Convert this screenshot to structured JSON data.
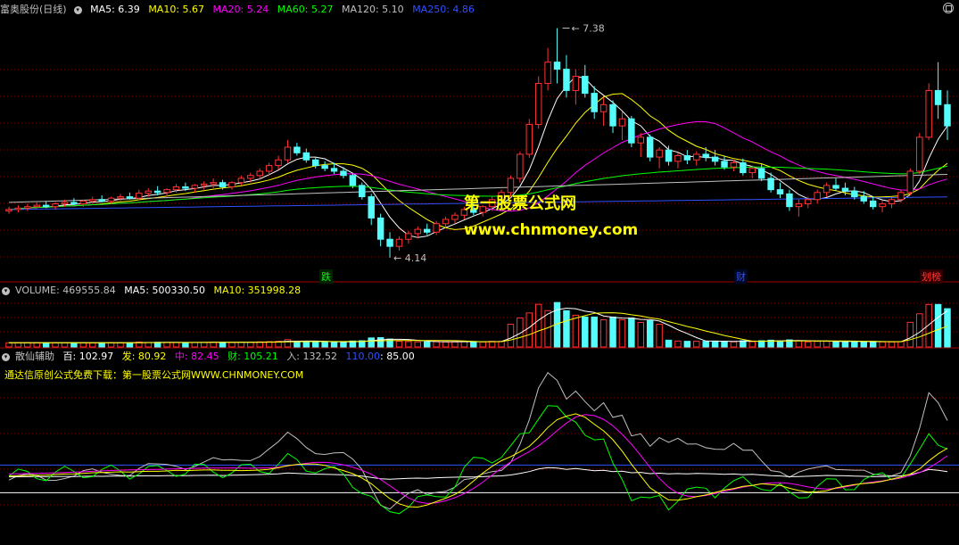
{
  "headers": {
    "main": {
      "name": "富奥股份(日线)",
      "ma": [
        {
          "label": "MA5: 6.39",
          "color": "#ffffff"
        },
        {
          "label": "MA10: 5.67",
          "color": "#ffff00"
        },
        {
          "label": "MA20: 5.24",
          "color": "#ff00ff"
        },
        {
          "label": "MA60: 5.27",
          "color": "#00ff00"
        },
        {
          "label": "MA120: 5.10",
          "color": "#c0c0c0"
        },
        {
          "label": "MA250: 4.86",
          "color": "#3050ff"
        }
      ]
    },
    "volume": [
      {
        "label": "VOLUME: 469555.84",
        "color": "#c0c0c0"
      },
      {
        "label": "MA5: 500330.50",
        "color": "#ffffff"
      },
      {
        "label": "MA10: 351998.28",
        "color": "#ffff00"
      }
    ],
    "indicator": [
      {
        "label": "散仙辅助",
        "color": "#c0c0c0"
      },
      {
        "label": "百: 102.97",
        "color": "#ffffff"
      },
      {
        "label": "发: 80.92",
        "color": "#ffff00"
      },
      {
        "label": "中: 82.45",
        "color": "#ff00ff"
      },
      {
        "label": "财: 105.21",
        "color": "#00ff00"
      },
      {
        "label": "入: 132.52",
        "color": "#c0c0c0"
      },
      {
        "label": "110.00",
        "color": "#3050ff"
      },
      {
        "label": ": 85.00",
        "color": "#ffffff"
      }
    ],
    "indicator_note": "通达信原创公式免费下载：第一股票公式网WWW.CHNMONEY.COM"
  },
  "watermark": {
    "line1": "第一股票公式网",
    "line2": "www.chnmoney.com"
  },
  "annotations": {
    "high": "7.38",
    "low": "4.14",
    "low_marker": "跌",
    "marker_cai": "财",
    "marker_right": "划榜"
  },
  "colors": {
    "up": "#ff3232",
    "down": "#54fcfc",
    "grid": "#7a0000",
    "divider": "#a00000"
  },
  "chart_data": [
    {
      "type": "candlestick",
      "title": "富奥股份(日线)",
      "ylim": [
        4.0,
        7.5
      ],
      "series_note": "approximate daily OHLC, left to right",
      "ohlc": [
        [
          4.8,
          4.86,
          4.76,
          4.82
        ],
        [
          4.82,
          4.88,
          4.78,
          4.84
        ],
        [
          4.84,
          4.9,
          4.8,
          4.86
        ],
        [
          4.86,
          4.92,
          4.82,
          4.88
        ],
        [
          4.88,
          4.94,
          4.84,
          4.86
        ],
        [
          4.86,
          4.92,
          4.82,
          4.9
        ],
        [
          4.9,
          4.96,
          4.86,
          4.92
        ],
        [
          4.92,
          4.98,
          4.88,
          4.9
        ],
        [
          4.9,
          4.96,
          4.86,
          4.94
        ],
        [
          4.94,
          5.0,
          4.9,
          4.96
        ],
        [
          4.96,
          5.02,
          4.92,
          4.94
        ],
        [
          4.94,
          5.0,
          4.9,
          4.98
        ],
        [
          4.98,
          5.04,
          4.94,
          5.0
        ],
        [
          5.0,
          5.06,
          4.96,
          4.98
        ],
        [
          4.98,
          5.1,
          4.95,
          5.05
        ],
        [
          5.05,
          5.12,
          5.0,
          5.08
        ],
        [
          5.08,
          5.15,
          5.02,
          5.06
        ],
        [
          5.06,
          5.12,
          5.0,
          5.1
        ],
        [
          5.1,
          5.18,
          5.06,
          5.14
        ],
        [
          5.14,
          5.2,
          5.08,
          5.12
        ],
        [
          5.12,
          5.18,
          5.06,
          5.16
        ],
        [
          5.16,
          5.22,
          5.1,
          5.18
        ],
        [
          5.18,
          5.26,
          5.12,
          5.2
        ],
        [
          5.2,
          5.24,
          5.1,
          5.14
        ],
        [
          5.14,
          5.22,
          5.1,
          5.2
        ],
        [
          5.2,
          5.3,
          5.16,
          5.26
        ],
        [
          5.26,
          5.34,
          5.2,
          5.3
        ],
        [
          5.3,
          5.4,
          5.24,
          5.36
        ],
        [
          5.36,
          5.48,
          5.3,
          5.44
        ],
        [
          5.44,
          5.58,
          5.38,
          5.52
        ],
        [
          5.52,
          5.8,
          5.48,
          5.7
        ],
        [
          5.7,
          5.76,
          5.58,
          5.62
        ],
        [
          5.62,
          5.68,
          5.48,
          5.52
        ],
        [
          5.52,
          5.56,
          5.4,
          5.44
        ],
        [
          5.44,
          5.5,
          5.36,
          5.4
        ],
        [
          5.4,
          5.48,
          5.32,
          5.36
        ],
        [
          5.36,
          5.42,
          5.26,
          5.3
        ],
        [
          5.3,
          5.34,
          5.12,
          5.16
        ],
        [
          5.16,
          5.2,
          4.96,
          5.0
        ],
        [
          5.0,
          5.04,
          4.6,
          4.7
        ],
        [
          4.7,
          4.76,
          4.3,
          4.4
        ],
        [
          4.4,
          4.5,
          4.14,
          4.3
        ],
        [
          4.3,
          4.44,
          4.24,
          4.4
        ],
        [
          4.4,
          4.52,
          4.34,
          4.48
        ],
        [
          4.48,
          4.58,
          4.42,
          4.54
        ],
        [
          4.54,
          4.62,
          4.46,
          4.5
        ],
        [
          4.5,
          4.66,
          4.46,
          4.62
        ],
        [
          4.62,
          4.72,
          4.56,
          4.68
        ],
        [
          4.68,
          4.78,
          4.62,
          4.74
        ],
        [
          4.74,
          4.86,
          4.68,
          4.82
        ],
        [
          4.82,
          4.92,
          4.74,
          4.78
        ],
        [
          4.78,
          4.88,
          4.72,
          4.86
        ],
        [
          4.86,
          5.0,
          4.8,
          4.96
        ],
        [
          4.96,
          5.1,
          4.9,
          5.06
        ],
        [
          5.06,
          5.3,
          5.0,
          5.26
        ],
        [
          5.26,
          5.64,
          5.2,
          5.6
        ],
        [
          5.6,
          6.1,
          5.55,
          6.02
        ],
        [
          6.02,
          6.7,
          5.96,
          6.6
        ],
        [
          6.6,
          7.1,
          6.5,
          6.9
        ],
        [
          6.9,
          7.38,
          6.6,
          6.8
        ],
        [
          6.8,
          7.0,
          6.4,
          6.5
        ],
        [
          6.5,
          6.8,
          6.3,
          6.7
        ],
        [
          6.7,
          6.86,
          6.4,
          6.46
        ],
        [
          6.46,
          6.56,
          6.1,
          6.2
        ],
        [
          6.2,
          6.4,
          6.0,
          6.3
        ],
        [
          6.3,
          6.36,
          5.9,
          6.0
        ],
        [
          6.0,
          6.2,
          5.8,
          6.1
        ],
        [
          6.1,
          6.14,
          5.7,
          5.76
        ],
        [
          5.76,
          5.9,
          5.56,
          5.84
        ],
        [
          5.84,
          5.88,
          5.5,
          5.56
        ],
        [
          5.56,
          5.7,
          5.4,
          5.66
        ],
        [
          5.66,
          5.72,
          5.44,
          5.5
        ],
        [
          5.5,
          5.62,
          5.4,
          5.58
        ],
        [
          5.58,
          5.66,
          5.46,
          5.52
        ],
        [
          5.52,
          5.64,
          5.44,
          5.6
        ],
        [
          5.6,
          5.7,
          5.5,
          5.56
        ],
        [
          5.56,
          5.66,
          5.44,
          5.5
        ],
        [
          5.5,
          5.58,
          5.38,
          5.42
        ],
        [
          5.42,
          5.52,
          5.36,
          5.48
        ],
        [
          5.48,
          5.54,
          5.3,
          5.34
        ],
        [
          5.34,
          5.44,
          5.26,
          5.4
        ],
        [
          5.4,
          5.46,
          5.22,
          5.26
        ],
        [
          5.26,
          5.34,
          5.06,
          5.1
        ],
        [
          5.1,
          5.2,
          4.98,
          5.04
        ],
        [
          5.04,
          5.1,
          4.8,
          4.86
        ],
        [
          4.86,
          4.96,
          4.72,
          4.9
        ],
        [
          4.9,
          5.0,
          4.84,
          4.96
        ],
        [
          4.96,
          5.1,
          4.9,
          5.06
        ],
        [
          5.06,
          5.2,
          5.0,
          5.16
        ],
        [
          5.16,
          5.26,
          5.08,
          5.12
        ],
        [
          5.12,
          5.2,
          5.02,
          5.08
        ],
        [
          5.08,
          5.14,
          4.96,
          5.0
        ],
        [
          5.0,
          5.08,
          4.9,
          4.94
        ],
        [
          4.94,
          5.0,
          4.82,
          4.86
        ],
        [
          4.86,
          4.94,
          4.78,
          4.9
        ],
        [
          4.9,
          5.0,
          4.84,
          4.96
        ],
        [
          4.96,
          5.1,
          4.92,
          5.06
        ],
        [
          5.06,
          5.4,
          5.02,
          5.36
        ],
        [
          5.36,
          5.9,
          5.32,
          5.84
        ],
        [
          5.84,
          6.6,
          5.8,
          6.5
        ],
        [
          6.5,
          6.9,
          6.1,
          6.3
        ],
        [
          6.3,
          6.5,
          5.8,
          6.0
        ]
      ],
      "ma_lines": [
        "MA5",
        "MA10",
        "MA20",
        "MA60",
        "MA120",
        "MA250"
      ]
    },
    {
      "type": "bar",
      "title": "VOLUME",
      "values_note": "approximate daily volume (units as shown)",
      "ylim": [
        0,
        1000000
      ]
    },
    {
      "type": "line",
      "title": "散仙辅助",
      "series": [
        {
          "name": "百",
          "color": "#ffffff"
        },
        {
          "name": "发",
          "color": "#ffff00"
        },
        {
          "name": "中",
          "color": "#ff00ff"
        },
        {
          "name": "财",
          "color": "#00ff00"
        },
        {
          "name": "入",
          "color": "#c0c0c0"
        }
      ],
      "reference_lines": [
        110.0,
        85.0
      ]
    }
  ]
}
